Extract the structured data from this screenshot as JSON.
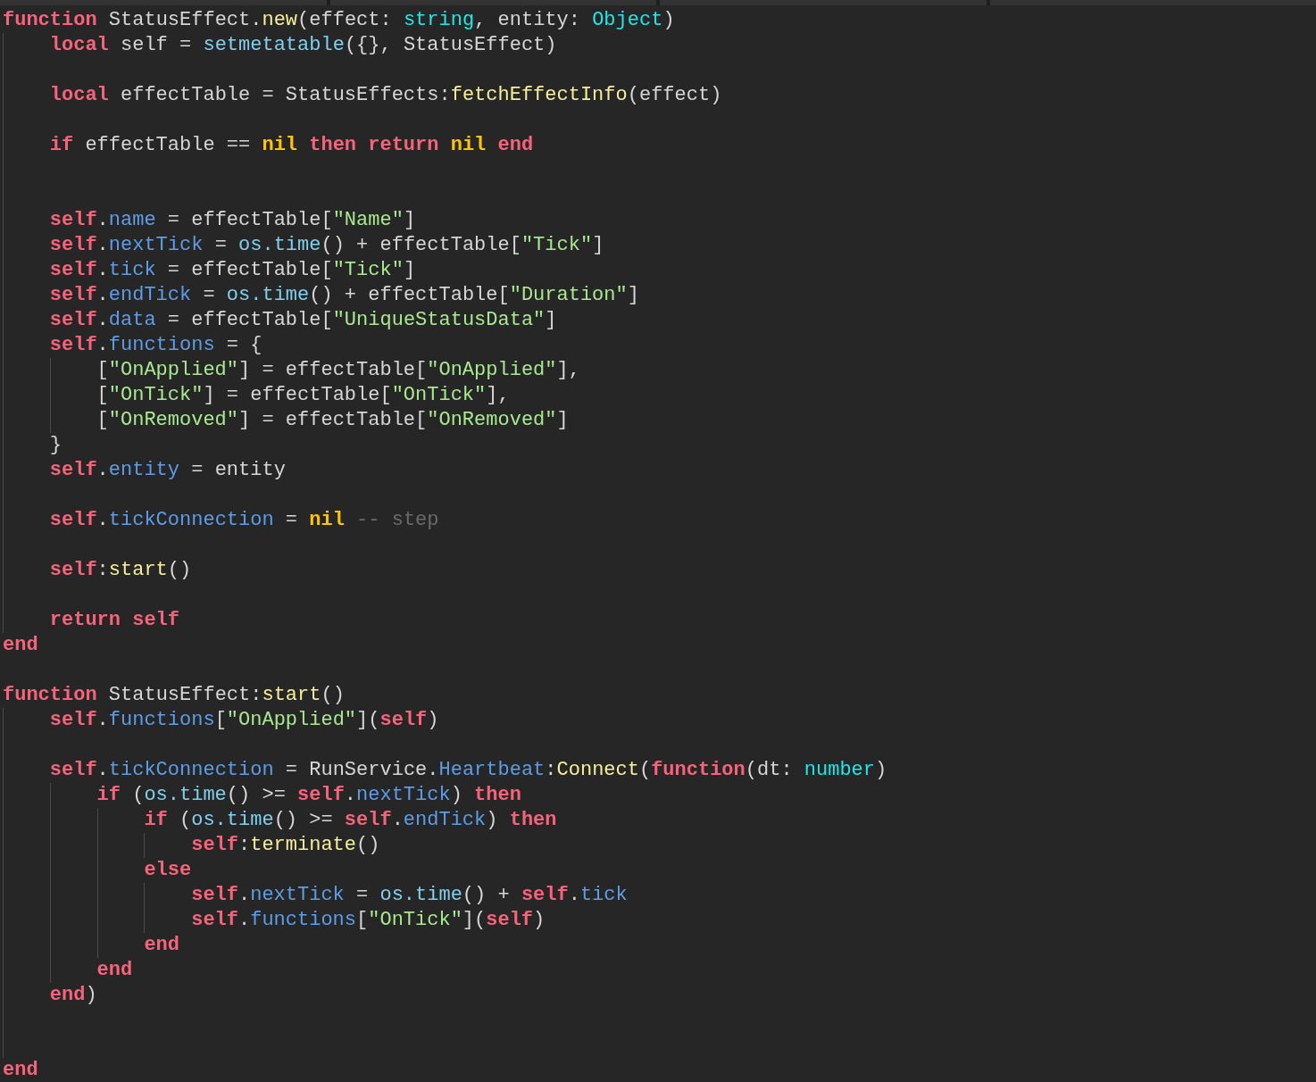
{
  "editor": {
    "lines": [
      {
        "kind": "code",
        "tokens": [
          {
            "kind": "kw",
            "text": "function"
          },
          {
            "kind": "txt",
            "text": " StatusEffect."
          },
          {
            "kind": "fn",
            "text": "new"
          },
          {
            "kind": "txt",
            "text": "(effect: "
          },
          {
            "kind": "type",
            "text": "string"
          },
          {
            "kind": "txt",
            "text": ", entity: "
          },
          {
            "kind": "type",
            "text": "Object"
          },
          {
            "kind": "txt",
            "text": ")"
          }
        ],
        "children": [
          {
            "kind": "code",
            "tokens": [
              {
                "kind": "kw",
                "text": "local"
              },
              {
                "kind": "txt",
                "text": " self = "
              },
              {
                "kind": "bi",
                "text": "setmetatable"
              },
              {
                "kind": "txt",
                "text": "({}, StatusEffect)"
              }
            ]
          },
          {
            "kind": "blank"
          },
          {
            "kind": "code",
            "tokens": [
              {
                "kind": "kw",
                "text": "local"
              },
              {
                "kind": "txt",
                "text": " effectTable = StatusEffects:"
              },
              {
                "kind": "fn",
                "text": "fetchEffectInfo"
              },
              {
                "kind": "txt",
                "text": "(effect)"
              }
            ]
          },
          {
            "kind": "blank"
          },
          {
            "kind": "code",
            "tokens": [
              {
                "kind": "kw",
                "text": "if"
              },
              {
                "kind": "txt",
                "text": " effectTable == "
              },
              {
                "kind": "nil",
                "text": "nil"
              },
              {
                "kind": "kw",
                "text": " then"
              },
              {
                "kind": "kw",
                "text": " return"
              },
              {
                "kind": "nil",
                "text": " nil"
              },
              {
                "kind": "kw",
                "text": " end"
              }
            ]
          },
          {
            "kind": "blank"
          },
          {
            "kind": "blank"
          },
          {
            "kind": "code",
            "tokens": [
              {
                "kind": "kw",
                "text": "self"
              },
              {
                "kind": "txt",
                "text": "."
              },
              {
                "kind": "field",
                "text": "name"
              },
              {
                "kind": "txt",
                "text": " = effectTable["
              },
              {
                "kind": "str",
                "text": "\"Name\""
              },
              {
                "kind": "txt",
                "text": "]"
              }
            ]
          },
          {
            "kind": "code",
            "tokens": [
              {
                "kind": "kw",
                "text": "self"
              },
              {
                "kind": "txt",
                "text": "."
              },
              {
                "kind": "field",
                "text": "nextTick"
              },
              {
                "kind": "txt",
                "text": " = "
              },
              {
                "kind": "bi",
                "text": "os.time"
              },
              {
                "kind": "txt",
                "text": "() + effectTable["
              },
              {
                "kind": "str",
                "text": "\"Tick\""
              },
              {
                "kind": "txt",
                "text": "]"
              }
            ]
          },
          {
            "kind": "code",
            "tokens": [
              {
                "kind": "kw",
                "text": "self"
              },
              {
                "kind": "txt",
                "text": "."
              },
              {
                "kind": "field",
                "text": "tick"
              },
              {
                "kind": "txt",
                "text": " = effectTable["
              },
              {
                "kind": "str",
                "text": "\"Tick\""
              },
              {
                "kind": "txt",
                "text": "]"
              }
            ]
          },
          {
            "kind": "code",
            "tokens": [
              {
                "kind": "kw",
                "text": "self"
              },
              {
                "kind": "txt",
                "text": "."
              },
              {
                "kind": "field",
                "text": "endTick"
              },
              {
                "kind": "txt",
                "text": " = "
              },
              {
                "kind": "bi",
                "text": "os.time"
              },
              {
                "kind": "txt",
                "text": "() + effectTable["
              },
              {
                "kind": "str",
                "text": "\"Duration\""
              },
              {
                "kind": "txt",
                "text": "]"
              }
            ]
          },
          {
            "kind": "code",
            "tokens": [
              {
                "kind": "kw",
                "text": "self"
              },
              {
                "kind": "txt",
                "text": "."
              },
              {
                "kind": "field",
                "text": "data"
              },
              {
                "kind": "txt",
                "text": " = effectTable["
              },
              {
                "kind": "str",
                "text": "\"UniqueStatusData\""
              },
              {
                "kind": "txt",
                "text": "]"
              }
            ]
          },
          {
            "kind": "code",
            "tokens": [
              {
                "kind": "kw",
                "text": "self"
              },
              {
                "kind": "txt",
                "text": "."
              },
              {
                "kind": "field",
                "text": "functions"
              },
              {
                "kind": "txt",
                "text": " = {"
              }
            ],
            "children": [
              {
                "kind": "code",
                "tokens": [
                  {
                    "kind": "txt",
                    "text": "["
                  },
                  {
                    "kind": "str",
                    "text": "\"OnApplied\""
                  },
                  {
                    "kind": "txt",
                    "text": "] = effectTable["
                  },
                  {
                    "kind": "str",
                    "text": "\"OnApplied\""
                  },
                  {
                    "kind": "txt",
                    "text": "],"
                  }
                ]
              },
              {
                "kind": "code",
                "tokens": [
                  {
                    "kind": "txt",
                    "text": "["
                  },
                  {
                    "kind": "str",
                    "text": "\"OnTick\""
                  },
                  {
                    "kind": "txt",
                    "text": "] = effectTable["
                  },
                  {
                    "kind": "str",
                    "text": "\"OnTick\""
                  },
                  {
                    "kind": "txt",
                    "text": "],"
                  }
                ]
              },
              {
                "kind": "code",
                "tokens": [
                  {
                    "kind": "txt",
                    "text": "["
                  },
                  {
                    "kind": "str",
                    "text": "\"OnRemoved\""
                  },
                  {
                    "kind": "txt",
                    "text": "] = effectTable["
                  },
                  {
                    "kind": "str",
                    "text": "\"OnRemoved\""
                  },
                  {
                    "kind": "txt",
                    "text": "]"
                  }
                ]
              }
            ]
          },
          {
            "kind": "code",
            "tokens": [
              {
                "kind": "txt",
                "text": "}"
              }
            ]
          },
          {
            "kind": "code",
            "tokens": [
              {
                "kind": "kw",
                "text": "self"
              },
              {
                "kind": "txt",
                "text": "."
              },
              {
                "kind": "field",
                "text": "entity"
              },
              {
                "kind": "txt",
                "text": " = entity"
              }
            ]
          },
          {
            "kind": "blank"
          },
          {
            "kind": "code",
            "tokens": [
              {
                "kind": "kw",
                "text": "self"
              },
              {
                "kind": "txt",
                "text": "."
              },
              {
                "kind": "field",
                "text": "tickConnection"
              },
              {
                "kind": "txt",
                "text": " = "
              },
              {
                "kind": "nil",
                "text": "nil"
              },
              {
                "kind": "cmt",
                "text": " -- step"
              }
            ]
          },
          {
            "kind": "blank"
          },
          {
            "kind": "code",
            "tokens": [
              {
                "kind": "kw",
                "text": "self"
              },
              {
                "kind": "txt",
                "text": ":"
              },
              {
                "kind": "fn",
                "text": "start"
              },
              {
                "kind": "txt",
                "text": "()"
              }
            ]
          },
          {
            "kind": "blank"
          },
          {
            "kind": "code",
            "tokens": [
              {
                "kind": "kw",
                "text": "return"
              },
              {
                "kind": "kw",
                "text": " self"
              }
            ]
          }
        ]
      },
      {
        "kind": "code",
        "tokens": [
          {
            "kind": "kw",
            "text": "end"
          }
        ]
      },
      {
        "kind": "blank"
      },
      {
        "kind": "code",
        "tokens": [
          {
            "kind": "kw",
            "text": "function"
          },
          {
            "kind": "txt",
            "text": " StatusEffect:"
          },
          {
            "kind": "fn",
            "text": "start"
          },
          {
            "kind": "txt",
            "text": "()"
          }
        ],
        "children": [
          {
            "kind": "code",
            "tokens": [
              {
                "kind": "kw",
                "text": "self"
              },
              {
                "kind": "txt",
                "text": "."
              },
              {
                "kind": "field",
                "text": "functions"
              },
              {
                "kind": "txt",
                "text": "["
              },
              {
                "kind": "str",
                "text": "\"OnApplied\""
              },
              {
                "kind": "txt",
                "text": "]("
              },
              {
                "kind": "kw",
                "text": "self"
              },
              {
                "kind": "txt",
                "text": ")"
              }
            ]
          },
          {
            "kind": "blank"
          },
          {
            "kind": "code",
            "tokens": [
              {
                "kind": "kw",
                "text": "self"
              },
              {
                "kind": "txt",
                "text": "."
              },
              {
                "kind": "field",
                "text": "tickConnection"
              },
              {
                "kind": "txt",
                "text": " = RunService."
              },
              {
                "kind": "field",
                "text": "Heartbeat"
              },
              {
                "kind": "txt",
                "text": ":"
              },
              {
                "kind": "fn",
                "text": "Connect"
              },
              {
                "kind": "txt",
                "text": "("
              },
              {
                "kind": "kw",
                "text": "function"
              },
              {
                "kind": "txt",
                "text": "(dt: "
              },
              {
                "kind": "type",
                "text": "number"
              },
              {
                "kind": "txt",
                "text": ")"
              }
            ],
            "children": [
              {
                "kind": "code",
                "tokens": [
                  {
                    "kind": "kw",
                    "text": "if"
                  },
                  {
                    "kind": "txt",
                    "text": " ("
                  },
                  {
                    "kind": "bi",
                    "text": "os.time"
                  },
                  {
                    "kind": "txt",
                    "text": "() >= "
                  },
                  {
                    "kind": "kw",
                    "text": "self"
                  },
                  {
                    "kind": "txt",
                    "text": "."
                  },
                  {
                    "kind": "field",
                    "text": "nextTick"
                  },
                  {
                    "kind": "txt",
                    "text": ")"
                  },
                  {
                    "kind": "kw",
                    "text": " then"
                  }
                ],
                "children": [
                  {
                    "kind": "code",
                    "tokens": [
                      {
                        "kind": "kw",
                        "text": "if"
                      },
                      {
                        "kind": "txt",
                        "text": " ("
                      },
                      {
                        "kind": "bi",
                        "text": "os.time"
                      },
                      {
                        "kind": "txt",
                        "text": "() >= "
                      },
                      {
                        "kind": "kw",
                        "text": "self"
                      },
                      {
                        "kind": "txt",
                        "text": "."
                      },
                      {
                        "kind": "field",
                        "text": "endTick"
                      },
                      {
                        "kind": "txt",
                        "text": ")"
                      },
                      {
                        "kind": "kw",
                        "text": " then"
                      }
                    ],
                    "children": [
                      {
                        "kind": "code",
                        "tokens": [
                          {
                            "kind": "kw",
                            "text": "self"
                          },
                          {
                            "kind": "txt",
                            "text": ":"
                          },
                          {
                            "kind": "fn",
                            "text": "terminate"
                          },
                          {
                            "kind": "txt",
                            "text": "()"
                          }
                        ]
                      }
                    ]
                  },
                  {
                    "kind": "code",
                    "tokens": [
                      {
                        "kind": "kw",
                        "text": "else"
                      }
                    ],
                    "children": [
                      {
                        "kind": "code",
                        "tokens": [
                          {
                            "kind": "kw",
                            "text": "self"
                          },
                          {
                            "kind": "txt",
                            "text": "."
                          },
                          {
                            "kind": "field",
                            "text": "nextTick"
                          },
                          {
                            "kind": "txt",
                            "text": " = "
                          },
                          {
                            "kind": "bi",
                            "text": "os.time"
                          },
                          {
                            "kind": "txt",
                            "text": "() + "
                          },
                          {
                            "kind": "kw",
                            "text": "self"
                          },
                          {
                            "kind": "txt",
                            "text": "."
                          },
                          {
                            "kind": "field",
                            "text": "tick"
                          }
                        ]
                      },
                      {
                        "kind": "code",
                        "tokens": [
                          {
                            "kind": "kw",
                            "text": "self"
                          },
                          {
                            "kind": "txt",
                            "text": "."
                          },
                          {
                            "kind": "field",
                            "text": "functions"
                          },
                          {
                            "kind": "txt",
                            "text": "["
                          },
                          {
                            "kind": "str",
                            "text": "\"OnTick\""
                          },
                          {
                            "kind": "txt",
                            "text": "]("
                          },
                          {
                            "kind": "kw",
                            "text": "self"
                          },
                          {
                            "kind": "txt",
                            "text": ")"
                          }
                        ]
                      }
                    ]
                  },
                  {
                    "kind": "code",
                    "tokens": [
                      {
                        "kind": "kw",
                        "text": "end"
                      }
                    ]
                  }
                ]
              },
              {
                "kind": "code",
                "tokens": [
                  {
                    "kind": "kw",
                    "text": "end"
                  }
                ]
              }
            ]
          },
          {
            "kind": "code",
            "tokens": [
              {
                "kind": "kw",
                "text": "end"
              },
              {
                "kind": "txt",
                "text": ")"
              }
            ]
          },
          {
            "kind": "blank"
          },
          {
            "kind": "blank"
          }
        ]
      },
      {
        "kind": "code",
        "tokens": [
          {
            "kind": "kw",
            "text": "end"
          }
        ]
      }
    ]
  }
}
